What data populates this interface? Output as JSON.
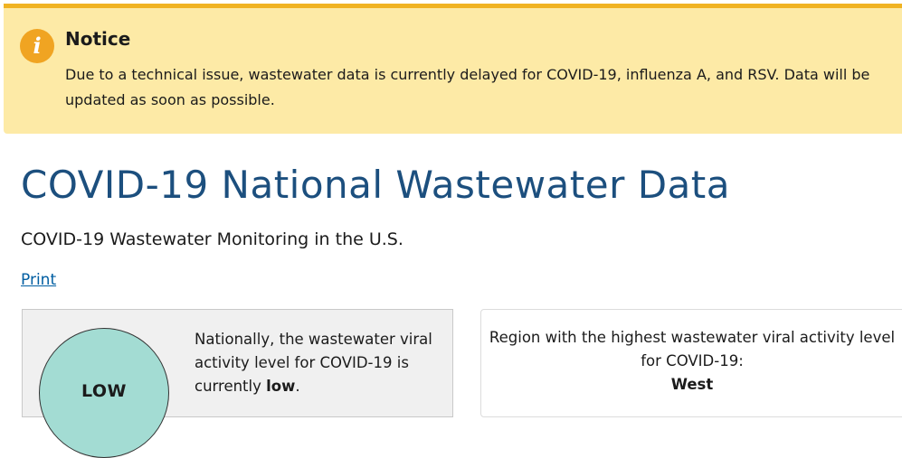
{
  "notice": {
    "icon": "info-icon",
    "icon_glyph": "i",
    "title": "Notice",
    "body": "Due to a technical issue, wastewater data is currently delayed for COVID-19, influenza A, and RSV. Data will be updated as soon as possible."
  },
  "page": {
    "title": "COVID-19 National Wastewater Data",
    "subtitle": "COVID-19 Wastewater Monitoring in the U.S.",
    "print_link": "Print"
  },
  "national": {
    "level_label": "LOW",
    "text_before": "Nationally, the wastewater viral activity level for COVID-19 is currently ",
    "level_word": "low",
    "text_after": "."
  },
  "region": {
    "text": "Region with the highest wastewater viral activity level for COVID-19:",
    "name": "West"
  },
  "colors": {
    "notice_bg": "#fdeaa6",
    "notice_border": "#f0b323",
    "title_color": "#1c4f7e",
    "link_color": "#005ea2",
    "low_level": "#a3dcd3"
  }
}
